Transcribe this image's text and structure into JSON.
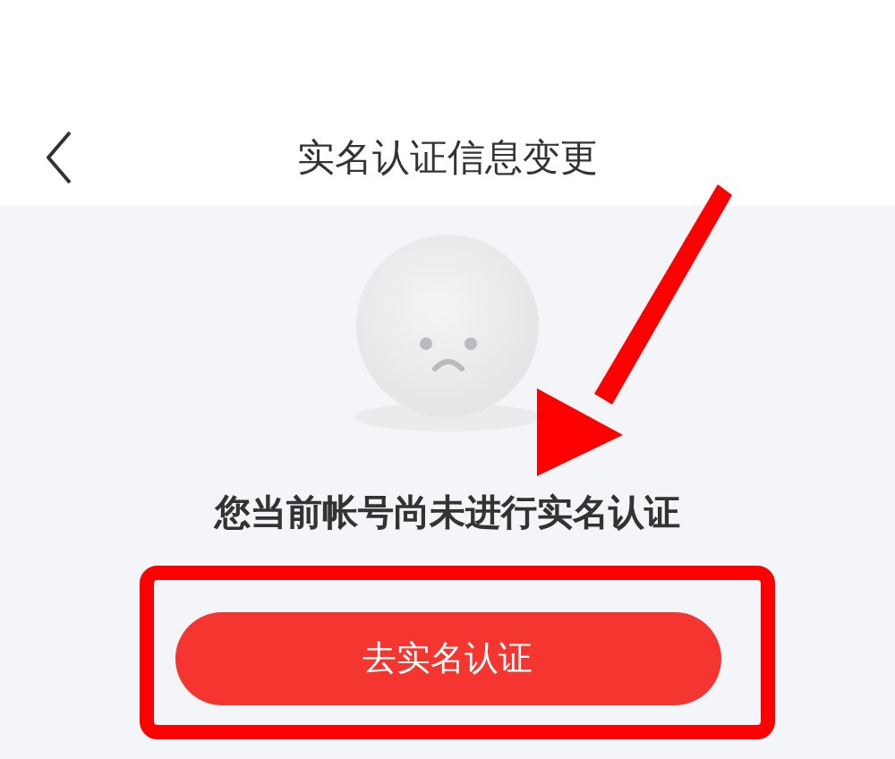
{
  "header": {
    "title": "实名认证信息变更"
  },
  "notice": {
    "message": "您当前帐号尚未进行实名认证"
  },
  "buttons": [
    {
      "label": "去实名认证"
    }
  ]
}
